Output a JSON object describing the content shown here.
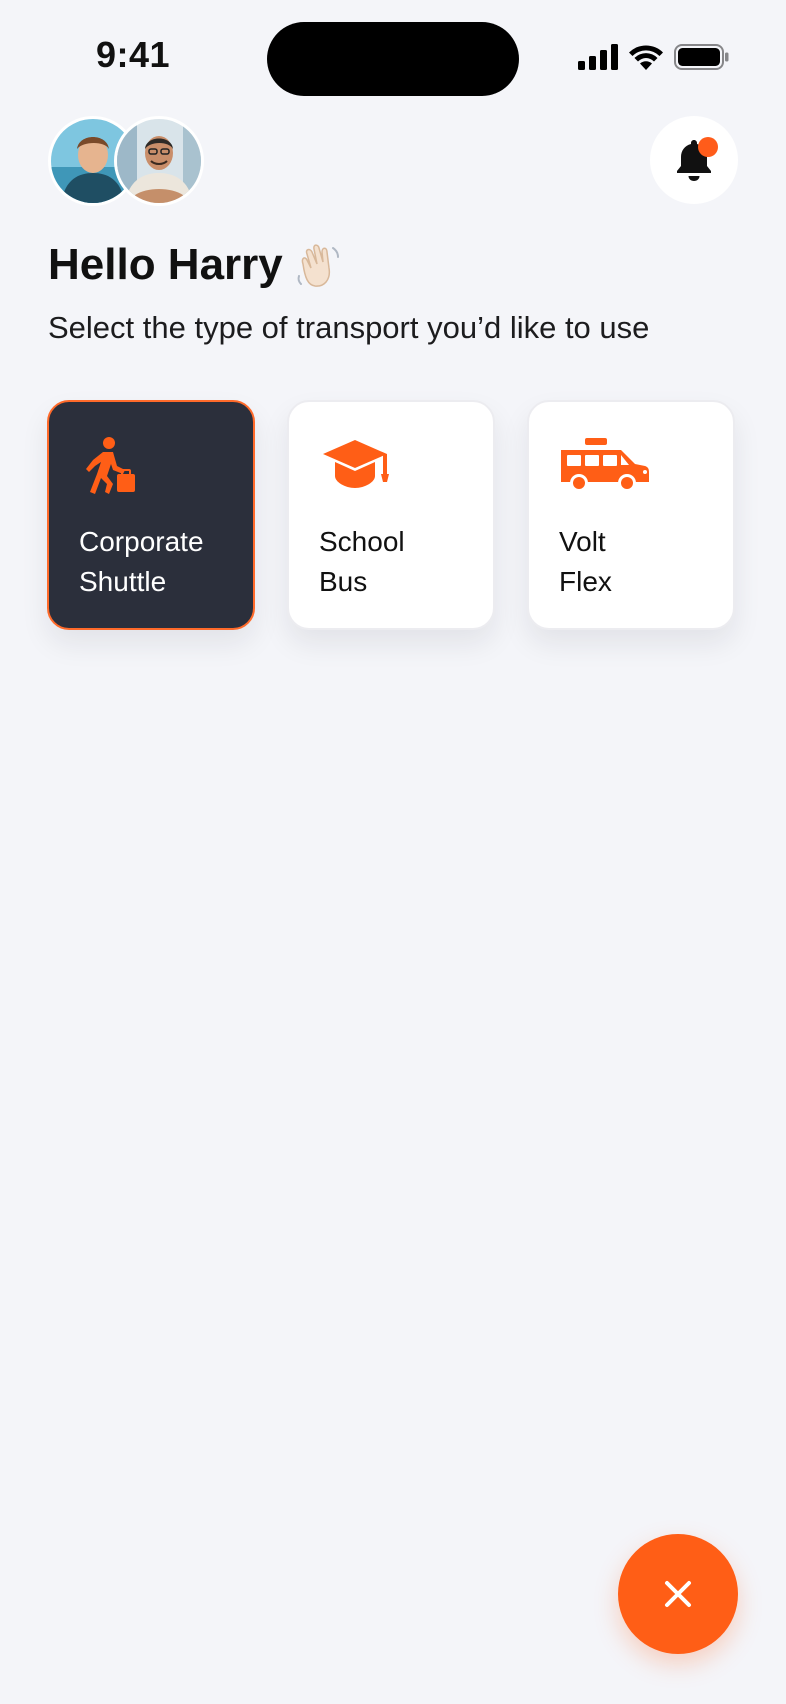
{
  "status_bar": {
    "time": "9:41"
  },
  "header": {
    "avatars": [
      {
        "name": "child-avatar"
      },
      {
        "name": "adult-avatar"
      }
    ],
    "bell_icon": "bell-icon",
    "has_notification": true
  },
  "greeting": {
    "title": "Hello Harry",
    "emoji": "👋🏻",
    "subtitle": "Select the type of transport you’d like to use"
  },
  "transport_options": [
    {
      "line1": "Corporate",
      "line2": "Shuttle",
      "icon": "walking-briefcase-icon",
      "selected": true
    },
    {
      "line1": "School",
      "line2": "Bus",
      "icon": "graduation-cap-icon",
      "selected": false
    },
    {
      "line1": "Volt",
      "line2": "Flex",
      "icon": "taxi-van-icon",
      "selected": false
    }
  ],
  "fab": {
    "icon": "close-icon"
  },
  "colors": {
    "accent": "#ff5e16",
    "selected_card": "#2b2f3b",
    "background": "#f4f5f9"
  }
}
